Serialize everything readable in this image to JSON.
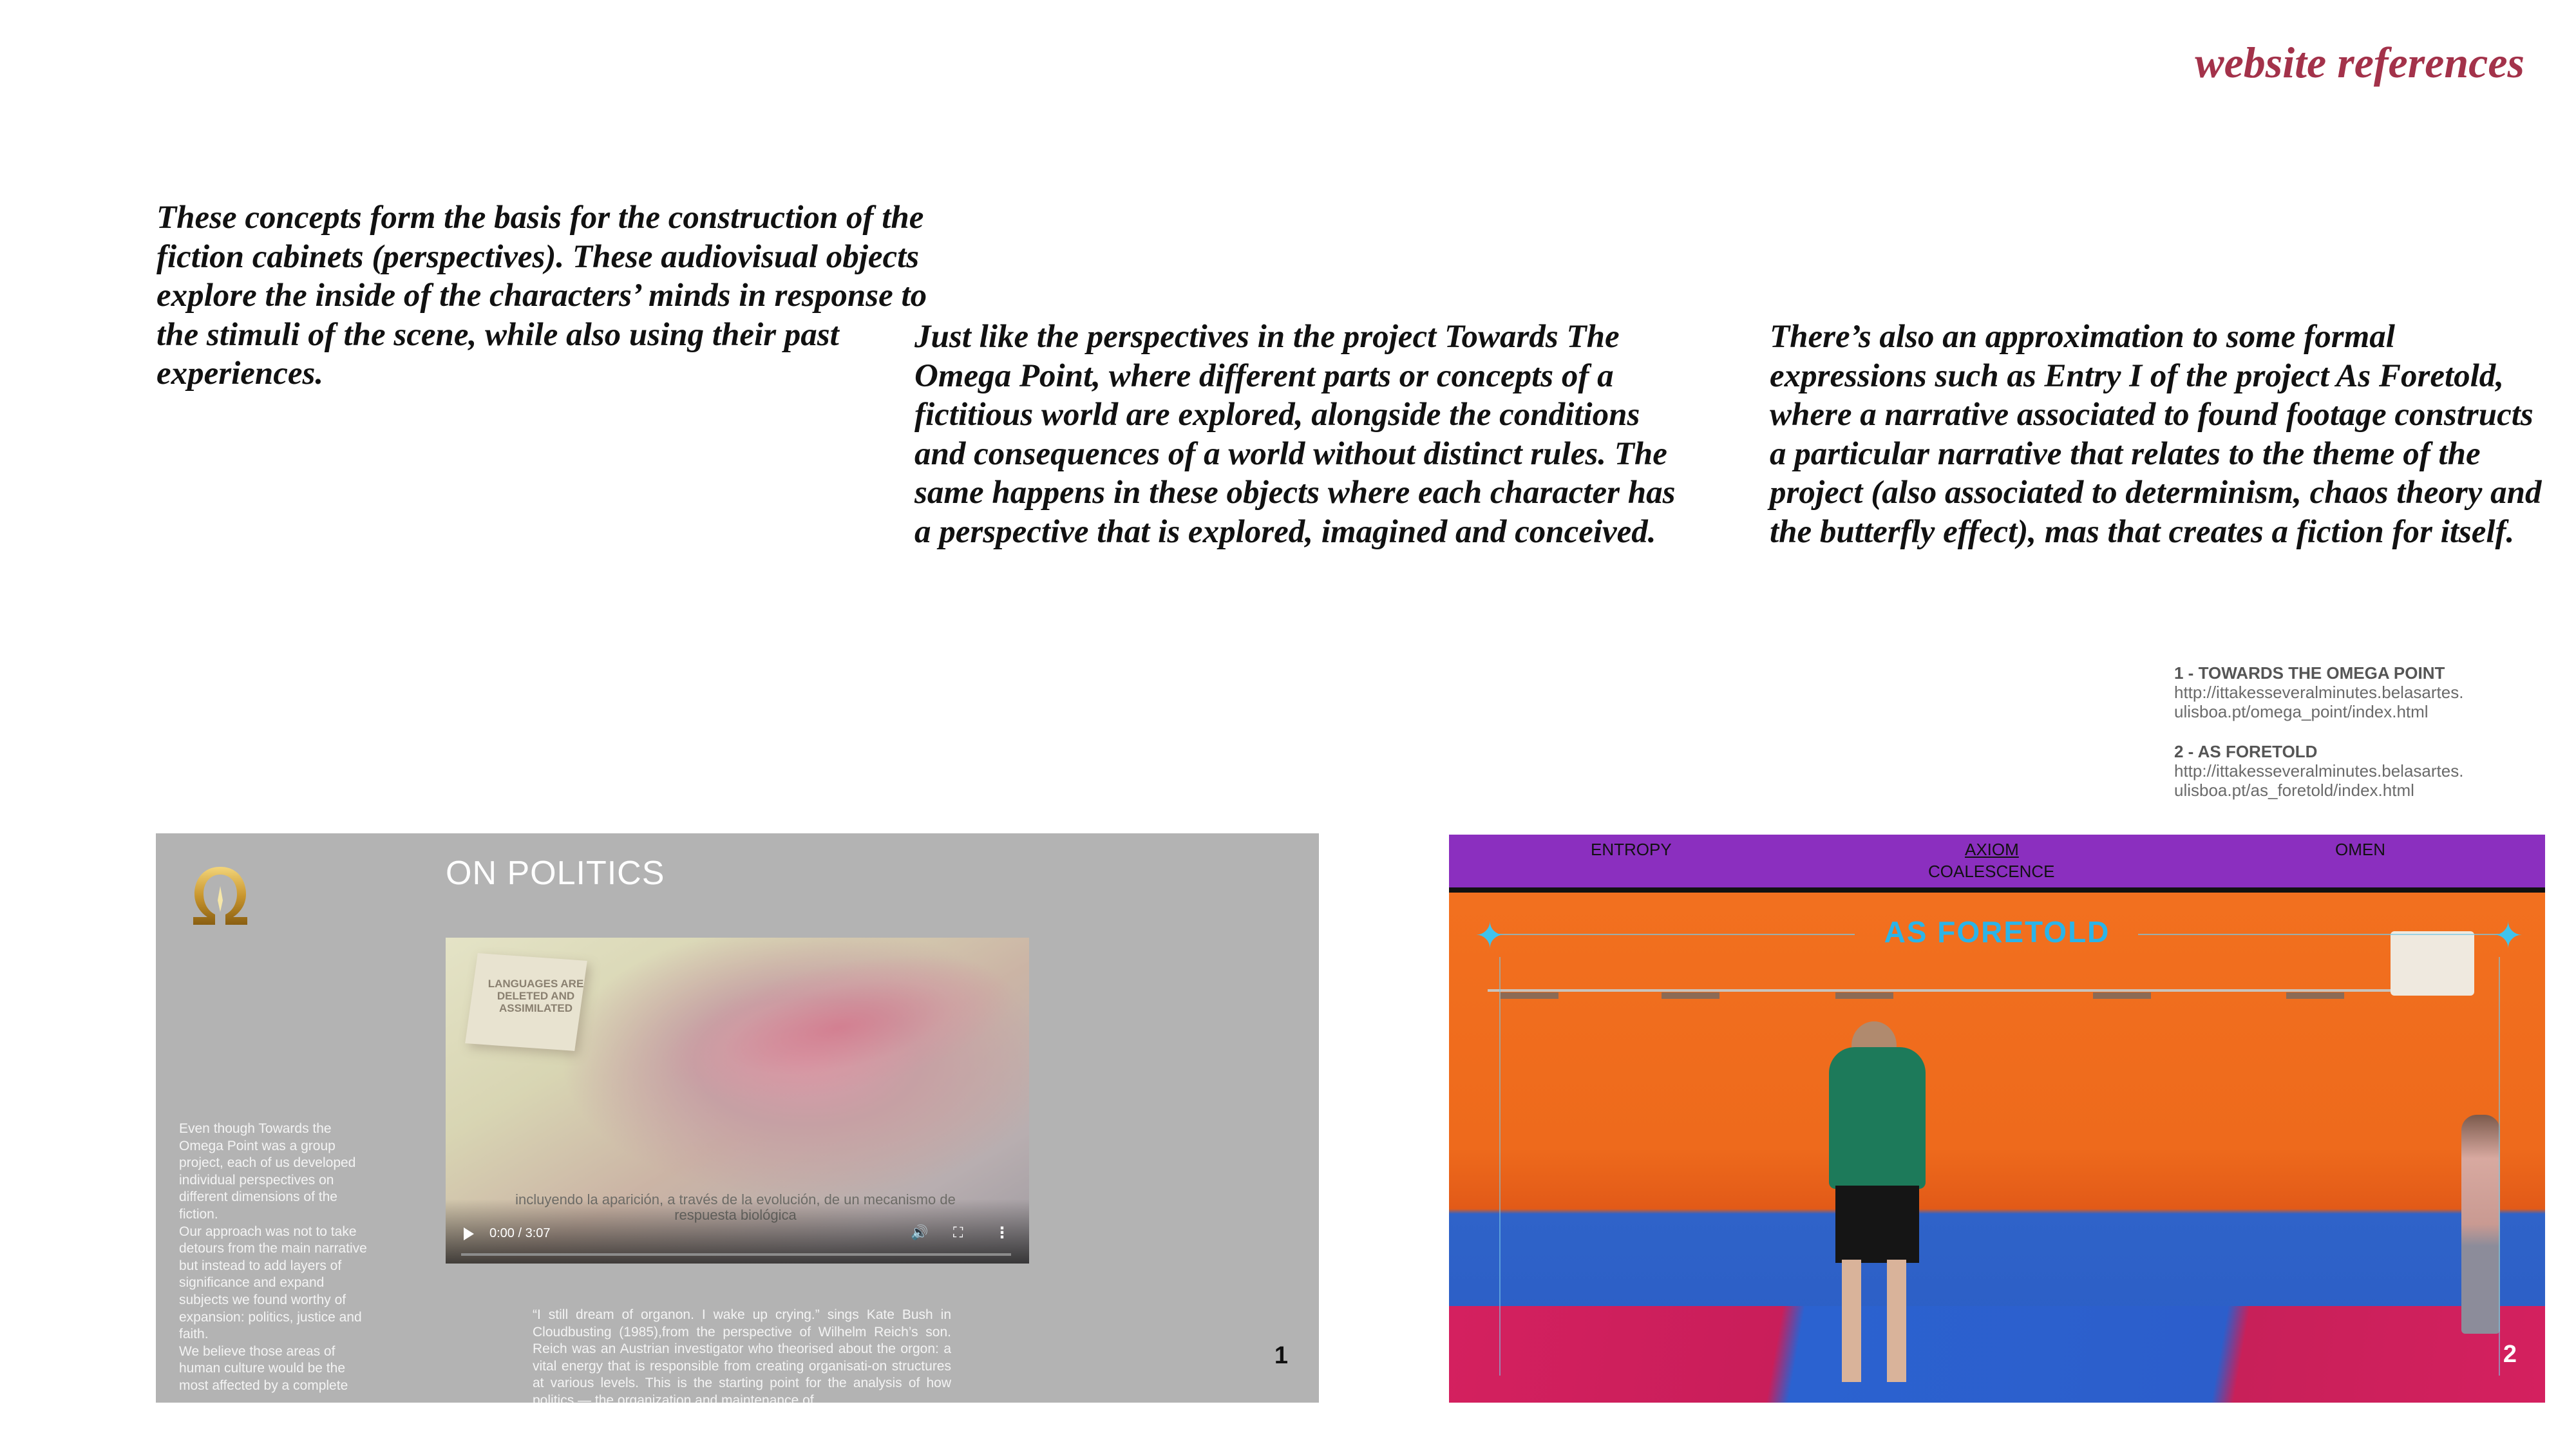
{
  "heading": "website references",
  "paragraphs": {
    "p1": "These concepts form the basis for the construction of the fiction cabinets (perspectives). These audiovisual objects explore the inside of the characters’ minds in response to the stimuli of the scene, while also using their past experiences.",
    "p2": "Just like the perspectives in the project Towards The Omega Point, where different parts or concepts of a fictitious world are explored, alongside the conditions and consequences of a world without distinct rules. The same happens in these objects where each character has a perspective that is explored, imagined and conceived.",
    "p3": "There’s also an approximation to some formal expressions such as Entry I of the project As Foretold, where a narrative associated to found footage constructs a particular narrative that relates to the theme of the project (also associated to determinism, chaos theory and the butterfly effect), mas that creates a fiction for itself."
  },
  "references": [
    {
      "title": "1 - TOWARDS THE OMEGA POINT",
      "url_line1": "http://ittakesseveralminutes.belasartes.",
      "url_line2": "ulisboa.pt/omega_point/index.html"
    },
    {
      "title": "2 - AS FORETOLD",
      "url_line1": "http://ittakesseveralminutes.belasartes.",
      "url_line2": "ulisboa.pt/as_foretold/index.html"
    }
  ],
  "shot1": {
    "logo_glyph": "Ω",
    "title": "ON POLITICS",
    "video": {
      "cube_text": "LANGUAGES ARE DELETED AND ASSIMILATED",
      "subtitle": "incluyendo la aparición, a través de la evolución, de un mecanismo de respuesta biológica",
      "time": "0:00 / 3:07",
      "progress": 0
    },
    "left_text": "Even though Towards the\nOmega Point was a group\nproject, each of us developed\nindividual perspectives on\ndifferent dimensions of the\nfiction.\nOur approach was not to take\ndetours from the main narrative\nbut instead to add layers of\nsignificance and expand\nsubjects we found worthy of\nexpansion: politics, justice and\nfaith.\nWe believe those areas of\nhuman culture would be the\nmost affected by a complete",
    "quote": "“I still dream of organon. I wake up crying.” sings Kate Bush in Cloudbusting (1985),from the perspective of Wilhelm Reich’s son. Reich was an Austrian investigator who theorised about the orgon: a vital energy that is responsible from creating organisati-on structures at various levels. This is the starting point for the analysis of how politics — the organization and maintenance of",
    "number": "1"
  },
  "shot2": {
    "nav": {
      "entropy": "ENTROPY",
      "axiom": "AXIOM",
      "omen": "OMEN",
      "coalescence": "COALESCENCE"
    },
    "title": "AS FORETOLD",
    "star_glyph": "✦",
    "number": "2"
  },
  "colors": {
    "heading": "#a3324a",
    "nav_bar": "#8b2fbf",
    "as_foretold": "#2bb4e8",
    "gray_panel": "#b3b3b3"
  }
}
